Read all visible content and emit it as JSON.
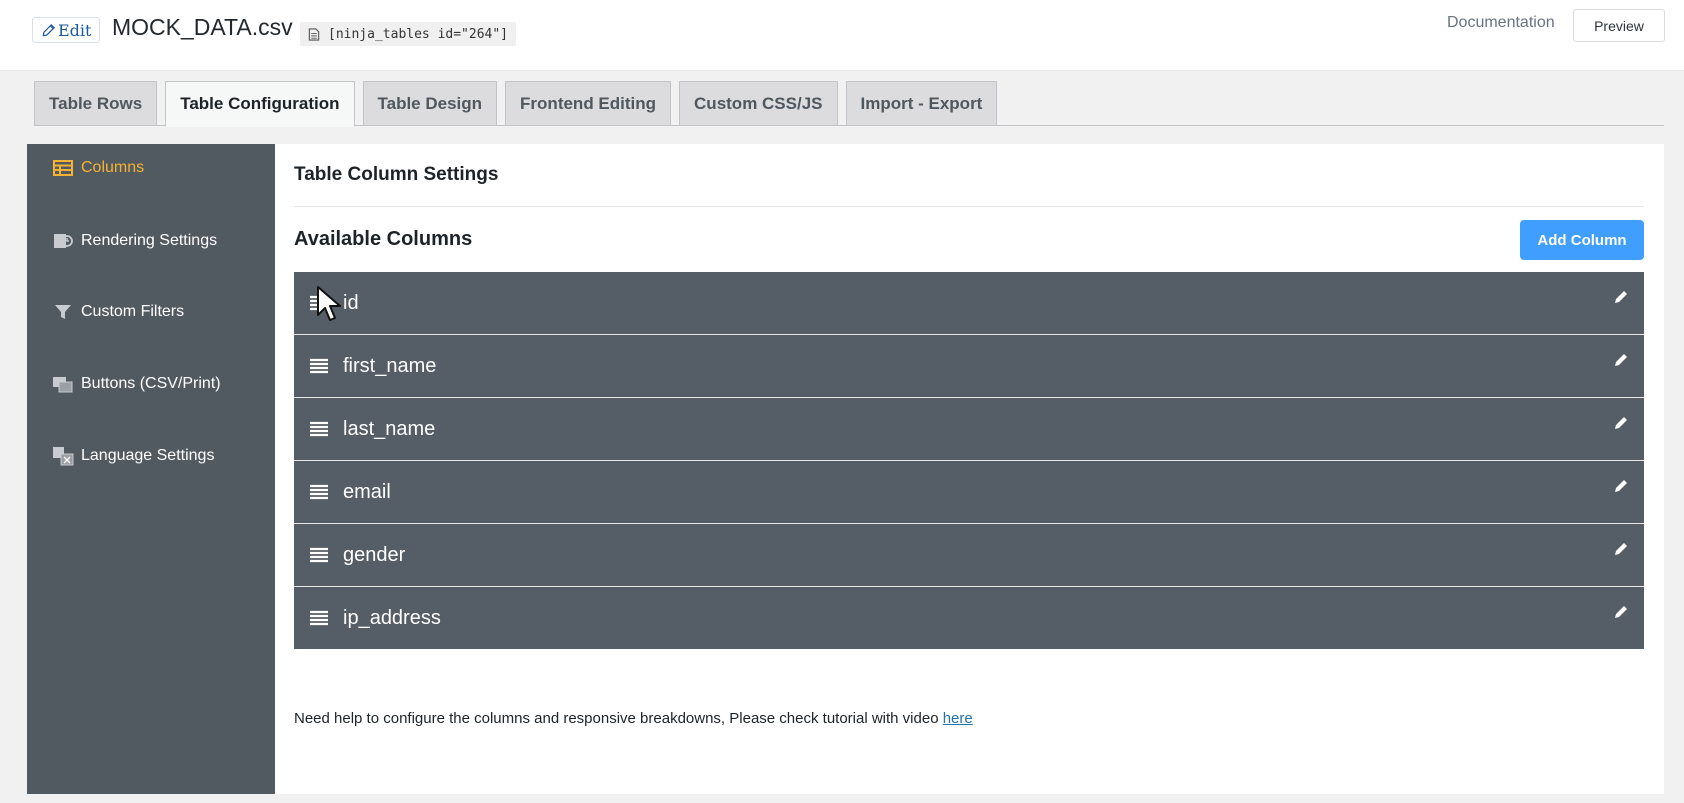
{
  "header": {
    "edit_label": "Edit",
    "table_title": "MOCK_DATA.csv",
    "shortcode": "[ninja_tables id=\"264\"]",
    "documentation_label": "Documentation",
    "preview_label": "Preview"
  },
  "tabs": [
    {
      "label": "Table Rows",
      "active": false
    },
    {
      "label": "Table Configuration",
      "active": true
    },
    {
      "label": "Table Design",
      "active": false
    },
    {
      "label": "Frontend Editing",
      "active": false
    },
    {
      "label": "Custom CSS/JS",
      "active": false
    },
    {
      "label": "Import - Export",
      "active": false
    }
  ],
  "sidebar": {
    "items": [
      {
        "label": "Columns",
        "icon": "table-icon",
        "active": true
      },
      {
        "label": "Rendering Settings",
        "icon": "render-icon",
        "active": false
      },
      {
        "label": "Custom Filters",
        "icon": "filter-icon",
        "active": false
      },
      {
        "label": "Buttons (CSV/Print)",
        "icon": "buttons-icon",
        "active": false
      },
      {
        "label": "Language Settings",
        "icon": "language-icon",
        "active": false
      }
    ]
  },
  "main": {
    "section_title": "Table Column Settings",
    "available_title": "Available Columns",
    "add_column_label": "Add Column",
    "columns": [
      {
        "name": "id"
      },
      {
        "name": "first_name"
      },
      {
        "name": "last_name"
      },
      {
        "name": "email"
      },
      {
        "name": "gender"
      },
      {
        "name": "ip_address"
      }
    ],
    "help_text": "Need help to configure the columns and responsive breakdowns, Please check tutorial with video ",
    "help_link": "here"
  },
  "colors": {
    "sidebar_bg": "#515961",
    "active_accent": "#f6b232",
    "row_bg": "#555d66",
    "button_blue": "#409eff"
  }
}
